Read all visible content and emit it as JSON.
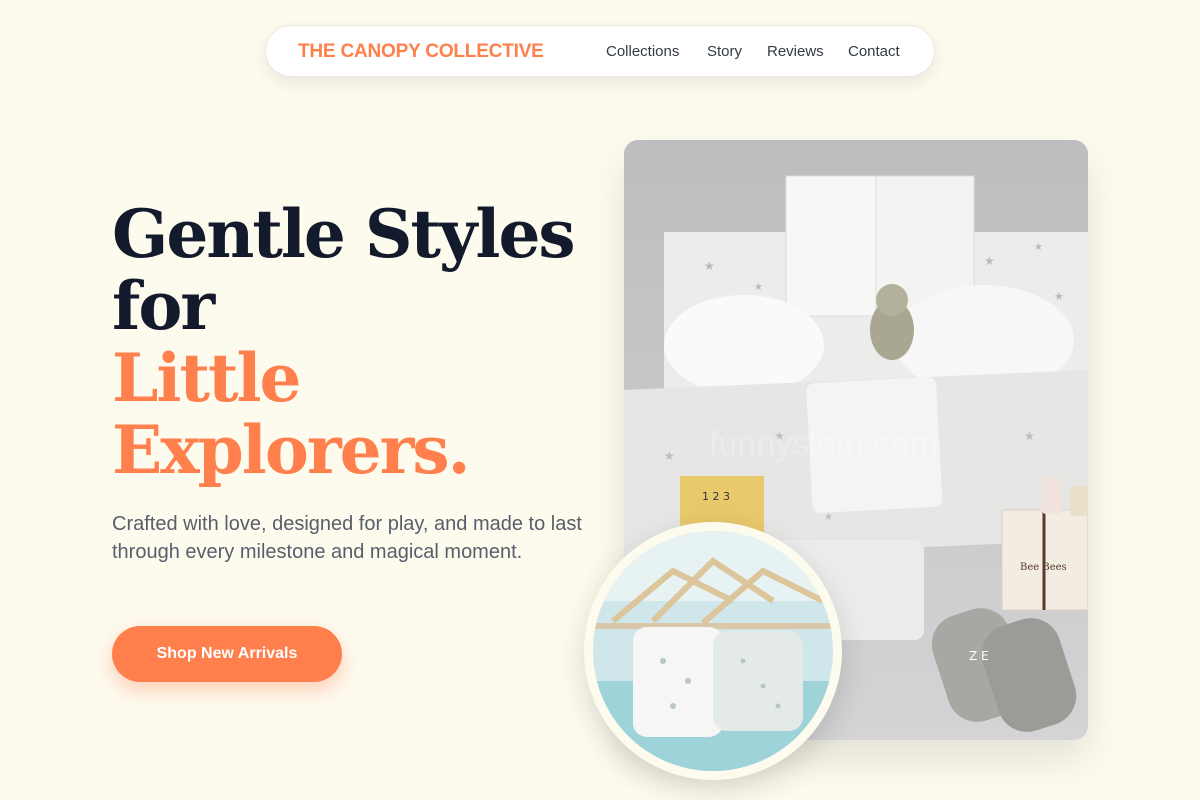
{
  "nav": {
    "brand": "THE CANOPY COLLECTIVE",
    "links": [
      "Collections",
      "Story",
      "Reviews",
      "Contact"
    ]
  },
  "hero": {
    "headline_line1": "Gentle Styles",
    "headline_line2": "for",
    "headline_accent1": "Little",
    "headline_accent2": "Explorers.",
    "subtext": "Crafted with love, designed for play, and made to last through every milestone and magical moment.",
    "cta_label": "Shop New Arrivals"
  },
  "images": {
    "main_watermark": "funnysloth.com",
    "main_box_label": "1 2 3",
    "main_gift_label": "Bee Bees",
    "main_swaddle_label": "Z E"
  },
  "colors": {
    "background": "#fdfaee",
    "accent": "#ff7f4d",
    "heading": "#121a2b",
    "body_text": "#585f6a"
  }
}
